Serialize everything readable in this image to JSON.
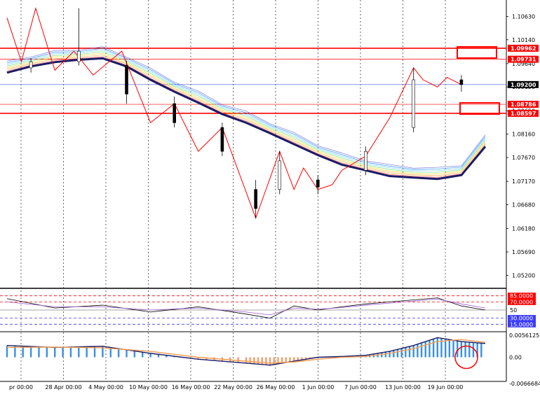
{
  "chart_data": [
    {
      "type": "line",
      "title": "",
      "x_ticks": [
        "pr 00:00",
        "28 Apr 00:00",
        "4 May 00:00",
        "10 May 00:00",
        "16 May 00:00",
        "22 May 00:00",
        "26 May 00:00",
        "1 Jun 00:00",
        "7 Jun 00:00",
        "13 Jun 00:00",
        "19 Jun 00:00"
      ],
      "y_ticks": [
        "1.10630",
        "1.10140",
        "1.09640",
        "1.09150",
        "1.08650",
        "1.08160",
        "1.07670",
        "1.07170",
        "1.06680",
        "1.06180",
        "1.05690",
        "1.05200"
      ],
      "ylim": [
        1.05,
        1.109
      ],
      "grid": true,
      "price_tags": [
        {
          "label": "1.09962",
          "value": 1.09962,
          "color": "#ff0000"
        },
        {
          "label": "1.09731",
          "value": 1.09731,
          "color": "#ff0000"
        },
        {
          "label": "1.09200",
          "value": 1.092,
          "color": "#000000"
        },
        {
          "label": "1.08786",
          "value": 1.08786,
          "color": "#ff0000"
        },
        {
          "label": "1.08597",
          "value": 1.08597,
          "color": "#ff0000"
        }
      ],
      "horizontal_lines": [
        1.09962,
        1.09731,
        1.092,
        1.08786,
        1.08597
      ],
      "series": [
        {
          "color": "#1a1a66",
          "x": [
            0,
            5,
            10,
            15,
            20,
            25,
            30,
            35,
            40,
            45,
            50,
            55,
            60,
            65,
            70,
            75,
            80,
            85,
            90,
            95,
            100
          ],
          "values": [
            1.0945,
            1.0958,
            1.0967,
            1.0972,
            1.0975,
            1.0958,
            1.093,
            1.0905,
            1.0882,
            1.0858,
            1.084,
            1.0818,
            1.0795,
            1.0772,
            1.0752,
            1.074,
            1.0728,
            1.0725,
            1.0722,
            1.073,
            1.079
          ]
        },
        {
          "color": "#ff0000",
          "x": [
            0,
            3,
            6,
            10,
            14,
            18,
            24,
            30,
            35,
            40,
            45,
            52,
            57,
            60,
            62,
            65,
            68,
            70,
            75,
            80,
            85,
            87,
            90,
            92,
            95
          ],
          "values": [
            1.106,
            1.0968,
            1.108,
            1.095,
            1.099,
            1.094,
            1.099,
            1.084,
            1.088,
            1.078,
            1.083,
            1.064,
            1.078,
            1.07,
            1.0745,
            1.07,
            1.071,
            1.074,
            1.077,
            1.085,
            1.0955,
            1.093,
            1.0915,
            1.0935,
            1.092
          ]
        }
      ],
      "candles": [
        {
          "x": 5,
          "open": 1.0955,
          "high": 1.0975,
          "low": 1.0945,
          "close": 1.0968
        },
        {
          "x": 15,
          "open": 1.0968,
          "high": 1.108,
          "low": 1.096,
          "close": 1.099
        },
        {
          "x": 25,
          "open": 1.096,
          "high": 1.097,
          "low": 1.088,
          "close": 1.09
        },
        {
          "x": 35,
          "open": 1.088,
          "high": 1.0895,
          "low": 1.083,
          "close": 1.084
        },
        {
          "x": 45,
          "open": 1.083,
          "high": 1.084,
          "low": 1.077,
          "close": 1.078
        },
        {
          "x": 52,
          "open": 1.07,
          "high": 1.072,
          "low": 1.064,
          "close": 1.066
        },
        {
          "x": 57,
          "open": 1.07,
          "high": 1.078,
          "low": 1.069,
          "close": 1.076
        },
        {
          "x": 65,
          "open": 1.072,
          "high": 1.073,
          "low": 1.069,
          "close": 1.0705
        },
        {
          "x": 75,
          "open": 1.074,
          "high": 1.079,
          "low": 1.073,
          "close": 1.078
        },
        {
          "x": 85,
          "open": 1.083,
          "high": 1.0955,
          "low": 1.082,
          "close": 1.093
        },
        {
          "x": 95,
          "open": 1.093,
          "high": 1.094,
          "low": 1.0905,
          "close": 1.092
        }
      ]
    },
    {
      "type": "line",
      "title": "",
      "y_ticks": [
        "85.0000",
        "70.0000",
        "50",
        "30.0000",
        "15.0000"
      ],
      "ylim": [
        0,
        100
      ],
      "levels": [
        85,
        70,
        50,
        30,
        15
      ],
      "series": [
        {
          "color": "#000000",
          "x": [
            0,
            10,
            20,
            30,
            40,
            50,
            55,
            60,
            65,
            70,
            75,
            80,
            85,
            90,
            95,
            100
          ],
          "values": [
            78,
            55,
            62,
            45,
            58,
            40,
            30,
            60,
            50,
            58,
            65,
            70,
            75,
            80,
            60,
            50
          ]
        },
        {
          "color": "#9b59d0",
          "x": [
            0,
            10,
            20,
            30,
            40,
            50,
            55,
            60,
            65,
            70,
            75,
            80,
            85,
            90,
            95,
            100
          ],
          "values": [
            70,
            58,
            58,
            50,
            55,
            45,
            38,
            55,
            52,
            56,
            62,
            67,
            72,
            77,
            65,
            55
          ]
        }
      ]
    },
    {
      "type": "bar",
      "title": "",
      "y_ticks": [
        "0.0056125",
        "0.00",
        "-0.0066684"
      ],
      "ylim": [
        -0.0066684,
        0.0056125
      ],
      "series": [
        {
          "color": "#1a1a66",
          "x": [
            0,
            10,
            20,
            30,
            40,
            50,
            55,
            60,
            65,
            70,
            75,
            80,
            85,
            90,
            95,
            100
          ],
          "values": [
            0.003,
            0.0025,
            0.0028,
            0.001,
            -0.0005,
            -0.0015,
            -0.002,
            -0.001,
            0.0,
            0.0002,
            0.0005,
            0.0015,
            0.003,
            0.005,
            0.004,
            0.0035
          ]
        },
        {
          "color": "#f39c50",
          "x": [
            0,
            10,
            20,
            30,
            40,
            50,
            55,
            60,
            65,
            70,
            75,
            80,
            85,
            90,
            95,
            100
          ],
          "values": [
            0.0025,
            0.0026,
            0.0024,
            0.0015,
            0.0,
            -0.001,
            -0.0015,
            -0.0012,
            -0.0005,
            0.0,
            0.0002,
            0.001,
            0.0022,
            0.004,
            0.0045,
            0.0038
          ]
        }
      ]
    }
  ]
}
